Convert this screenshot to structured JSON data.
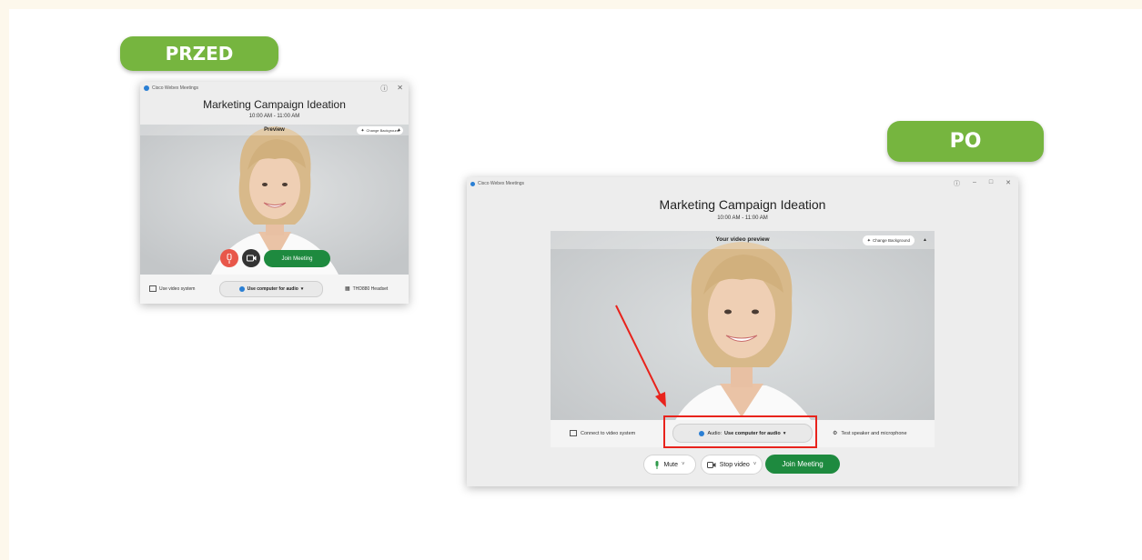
{
  "labels": {
    "before": "PRZED",
    "after": "PO"
  },
  "before": {
    "app_title": "Cisco Webex Meetings",
    "meeting_title": "Marketing Campaign Ideation",
    "meeting_time": "10:00 AM - 11:00 AM",
    "preview_label": "Preview",
    "change_background": "Change Background",
    "join_button": "Join Meeting",
    "video_system": "Use video system",
    "audio": "Use computer for audio",
    "speaker": "THD880 Headset"
  },
  "after": {
    "app_title": "Cisco Webex Meetings",
    "meeting_title": "Marketing Campaign Ideation",
    "meeting_time": "10:00 AM - 11:00 AM",
    "preview_label": "Your video preview",
    "change_background": "Change Background",
    "connect_video": "Connect to video system",
    "audio_prefix": "Audio:",
    "audio_value": "Use computer for audio",
    "test_speaker": "Test speaker and microphone",
    "mute": "Mute",
    "stop_video": "Stop video",
    "join_button": "Join Meeting"
  },
  "colors": {
    "label_green": "#76b53f",
    "join_green": "#1e8a3f",
    "highlight_red": "#e8231c",
    "mute_red": "#e8574a"
  }
}
